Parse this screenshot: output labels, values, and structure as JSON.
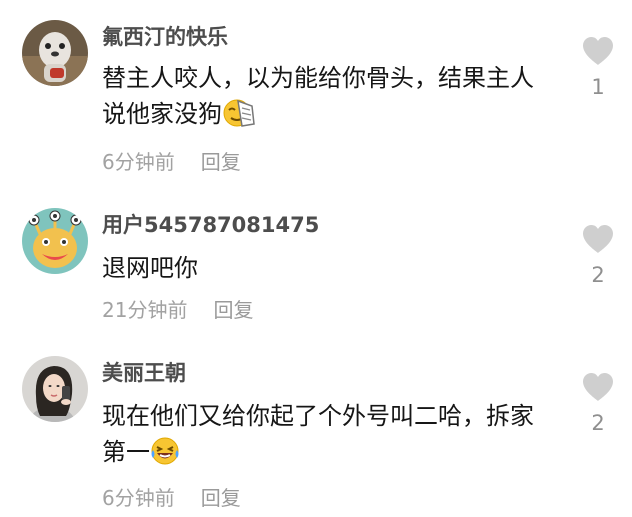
{
  "comments": [
    {
      "username": "氟西汀的快乐",
      "text": "替主人咬人，以为能给你骨头，结果主人说他家没狗",
      "emoji": "facepalm-emoji",
      "time": "6分钟前",
      "reply": "回复",
      "likes": "1"
    },
    {
      "username": "用户545787081475",
      "text": "退网吧你",
      "time": "21分钟前",
      "reply": "回复",
      "likes": "2"
    },
    {
      "username": "美丽王朝",
      "text": "现在他们又给你起了个外号叫二哈，拆家第一",
      "emoji": "laughing-crying-emoji",
      "time": "6分钟前",
      "reply": "回复",
      "likes": "2"
    }
  ],
  "colors": {
    "username": "#4d4d4d",
    "text": "#161616",
    "meta": "#a2a2a2",
    "heart": "#cfcfcf"
  }
}
